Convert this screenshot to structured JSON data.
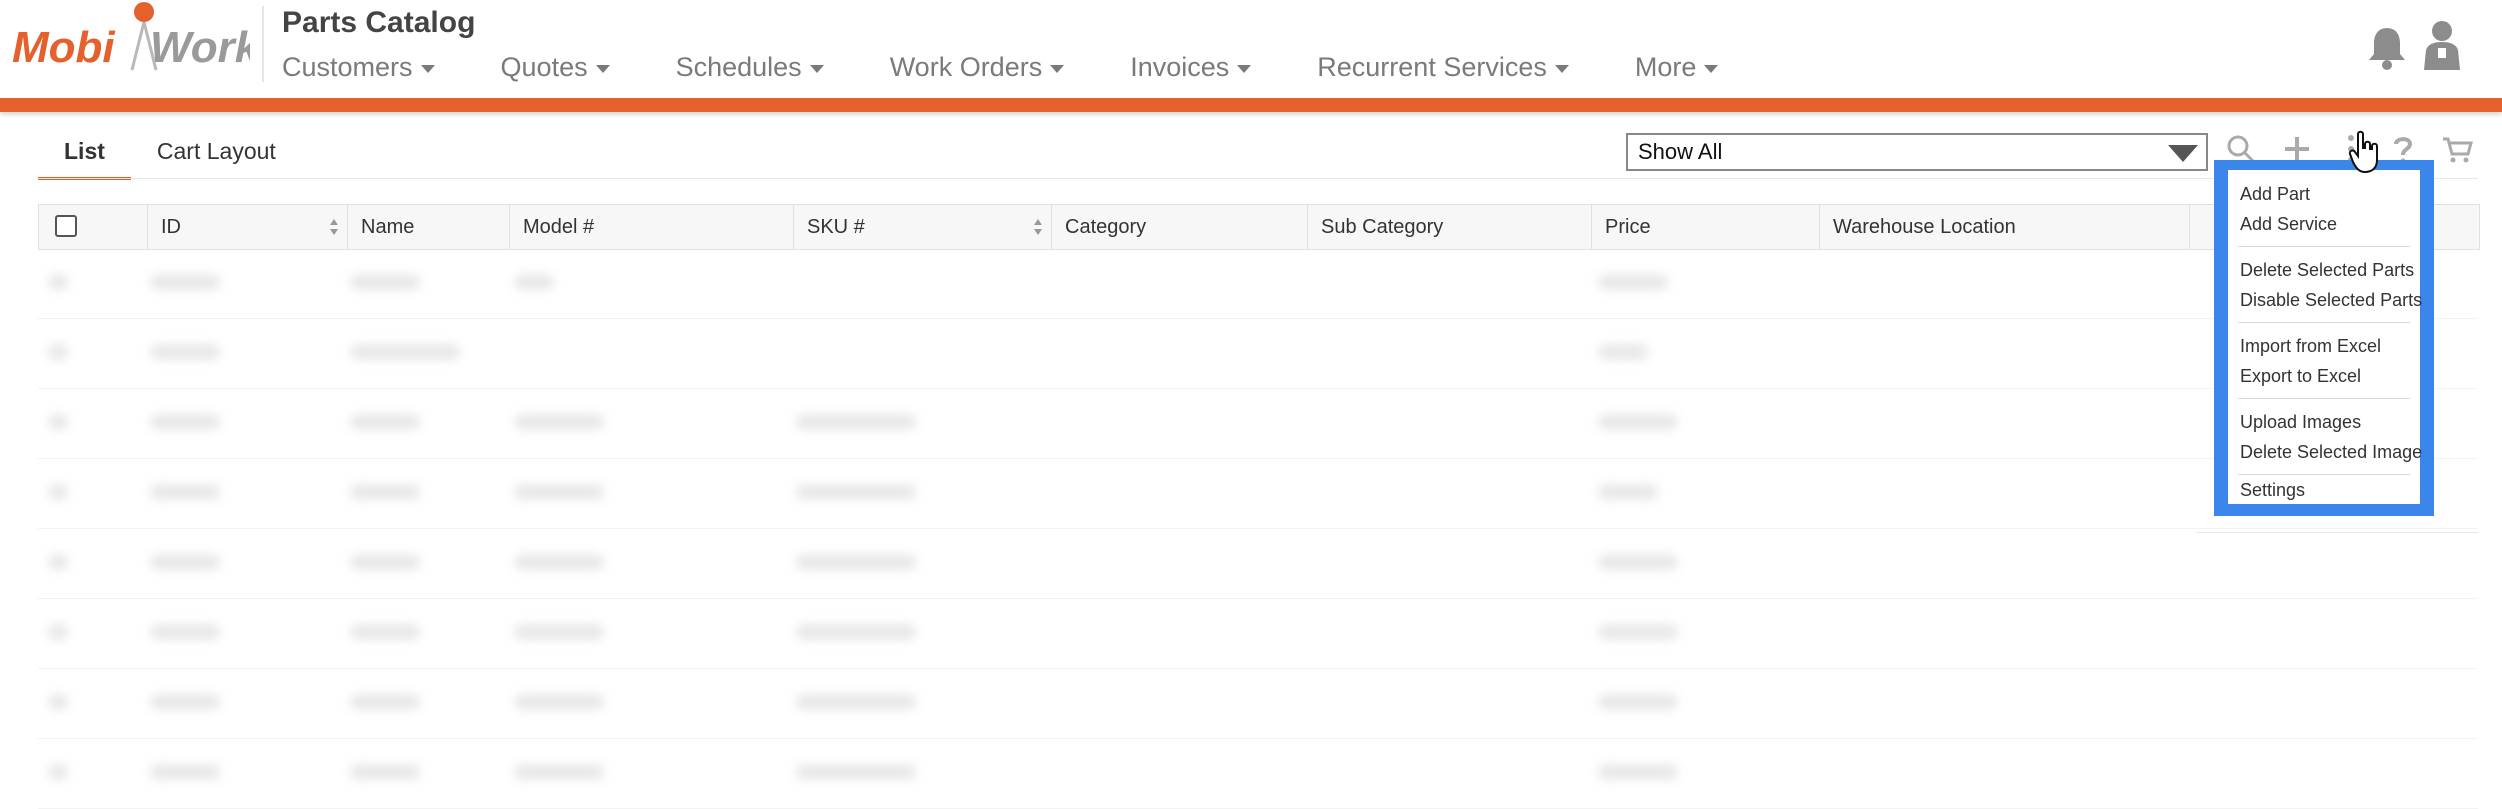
{
  "app": {
    "title": "Parts Catalog",
    "logo_text_left": "Mobi",
    "logo_text_right": "Work"
  },
  "nav": [
    {
      "label": "Customers"
    },
    {
      "label": "Quotes"
    },
    {
      "label": "Schedules"
    },
    {
      "label": "Work Orders"
    },
    {
      "label": "Invoices"
    },
    {
      "label": "Recurrent Services"
    },
    {
      "label": "More"
    }
  ],
  "tabs": [
    {
      "label": "List",
      "active": true
    },
    {
      "label": "Cart Layout",
      "active": false
    }
  ],
  "filter": {
    "selected": "Show All"
  },
  "table": {
    "columns": [
      "ID",
      "Name",
      "Model #",
      "SKU #",
      "Category",
      "Sub Category",
      "Price",
      "Warehouse Location"
    ]
  },
  "menu": {
    "groups": [
      [
        "Add Part",
        "Add Service"
      ],
      [
        "Delete Selected Parts",
        "Disable Selected Parts"
      ],
      [
        "Import from Excel",
        "Export to Excel"
      ],
      [
        "Upload Images",
        "Delete Selected Image"
      ],
      [
        "Settings"
      ]
    ]
  },
  "colors": {
    "brand_orange": "#e4602c",
    "highlight_blue": "#3b86ea"
  },
  "icons": [
    "bell-icon",
    "user-icon",
    "search-icon",
    "plus-icon",
    "more-icon",
    "help-icon",
    "cart-icon",
    "hand-cursor-icon"
  ]
}
